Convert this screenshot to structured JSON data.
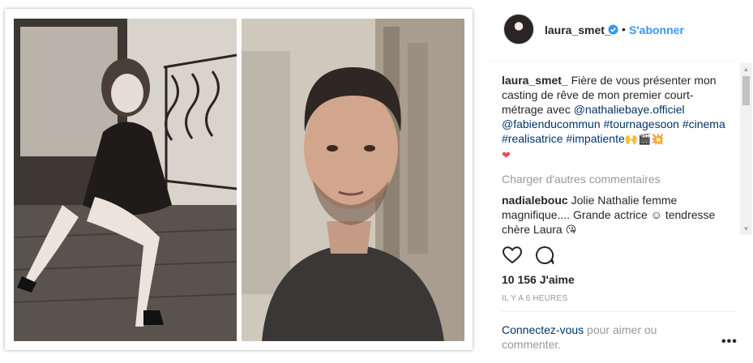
{
  "post": {
    "image_alt": "Collage of two portraits: a woman seated in a black dress by a balcony railing, and a man in a dark sweater"
  },
  "header": {
    "username": "laura_smet_",
    "dot": "•",
    "follow_label": "S'abonner"
  },
  "caption": {
    "author": "laura_smet_",
    "text": " Fière de vous présenter mon casting de rêve de mon premier court-métrage avec ",
    "mention1": "@nathaliebaye.officiel",
    "mention2": "@fabienducommun",
    "hashtag1": "#tournagesoon",
    "hashtag2": "#cinema",
    "hashtag3": "#realisatrice",
    "hashtag4": "#impatiente",
    "emojis": "🙌🎬💥",
    "heart": "❤"
  },
  "load_more_label": "Charger d'autres commentaires",
  "comments": [
    {
      "author": "nadialebouc",
      "text": " Jolie Nathalie femme magnifique.... Grande actrice ☺ tendresse chère Laura ",
      "emoji": "😘"
    }
  ],
  "likes_label": "10 156 J'aime",
  "timestamp": "IL Y A 6 HEURES",
  "login": {
    "link": "Connectez-vous",
    "text": " pour aimer ou commenter."
  },
  "more_label": "•••",
  "colors": {
    "link_blue": "#3897f0",
    "tag_dark_blue": "#003569",
    "muted_gray": "#999999",
    "verified_blue": "#3897f0"
  }
}
